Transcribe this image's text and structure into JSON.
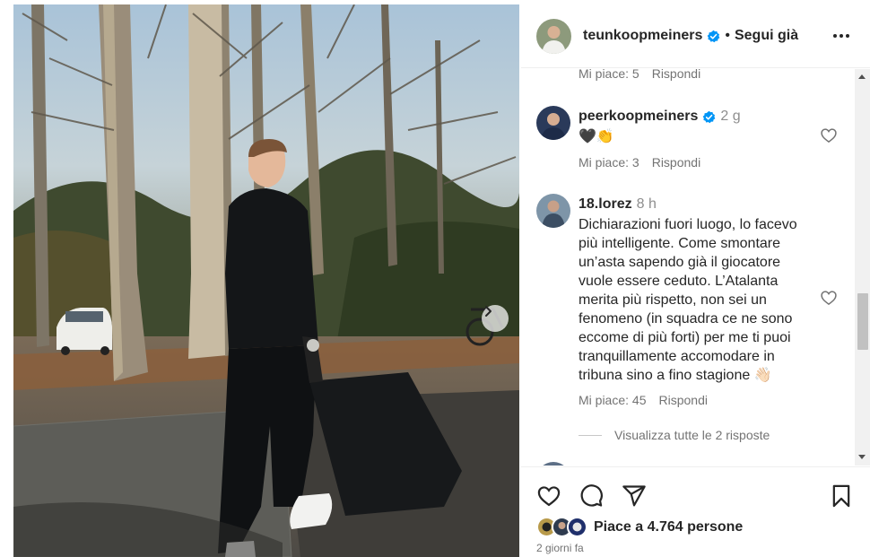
{
  "post": {
    "image_alt": "",
    "author": "teunkoopmeiners",
    "separator": "•",
    "follow_status": "Segui già"
  },
  "comments": {
    "previous_meta": {
      "likes": "Mi piace: 5",
      "reply": "Rispondi"
    },
    "items": [
      {
        "user": "peerkoopmeiners",
        "verified": true,
        "time": "2 g",
        "text": "🖤👏",
        "likes": "Mi piace: 3",
        "reply": "Rispondi"
      },
      {
        "user": "18.lorez",
        "verified": false,
        "time": "8 h",
        "text": "Dichiarazioni fuori luogo, lo facevo più intelligente. Come smontare un’asta sapendo già il giocatore vuole essere ceduto. L’Atalanta merita più rispetto, non sei un fenomeno (in squadra ce ne sono eccome di più forti) per me ti puoi tranquillamente accomodare in tribuna sino a fino stagione 👋🏻",
        "likes": "Mi piace: 45",
        "reply": "Rispondi"
      }
    ],
    "view_replies": "Visualizza tutte le 2 risposte"
  },
  "footer": {
    "likes_text": "Piace a 4.764 persone",
    "date": "2 giorni fa"
  },
  "icons": {
    "verified": "verified-badge-icon",
    "more": "more-options-icon",
    "like": "heart-icon",
    "comment": "comment-icon",
    "share": "share-icon",
    "save": "bookmark-icon",
    "next": "chevron-right-icon"
  },
  "colors": {
    "verified": "#0095f6",
    "text": "#262626",
    "secondary": "#737373"
  }
}
